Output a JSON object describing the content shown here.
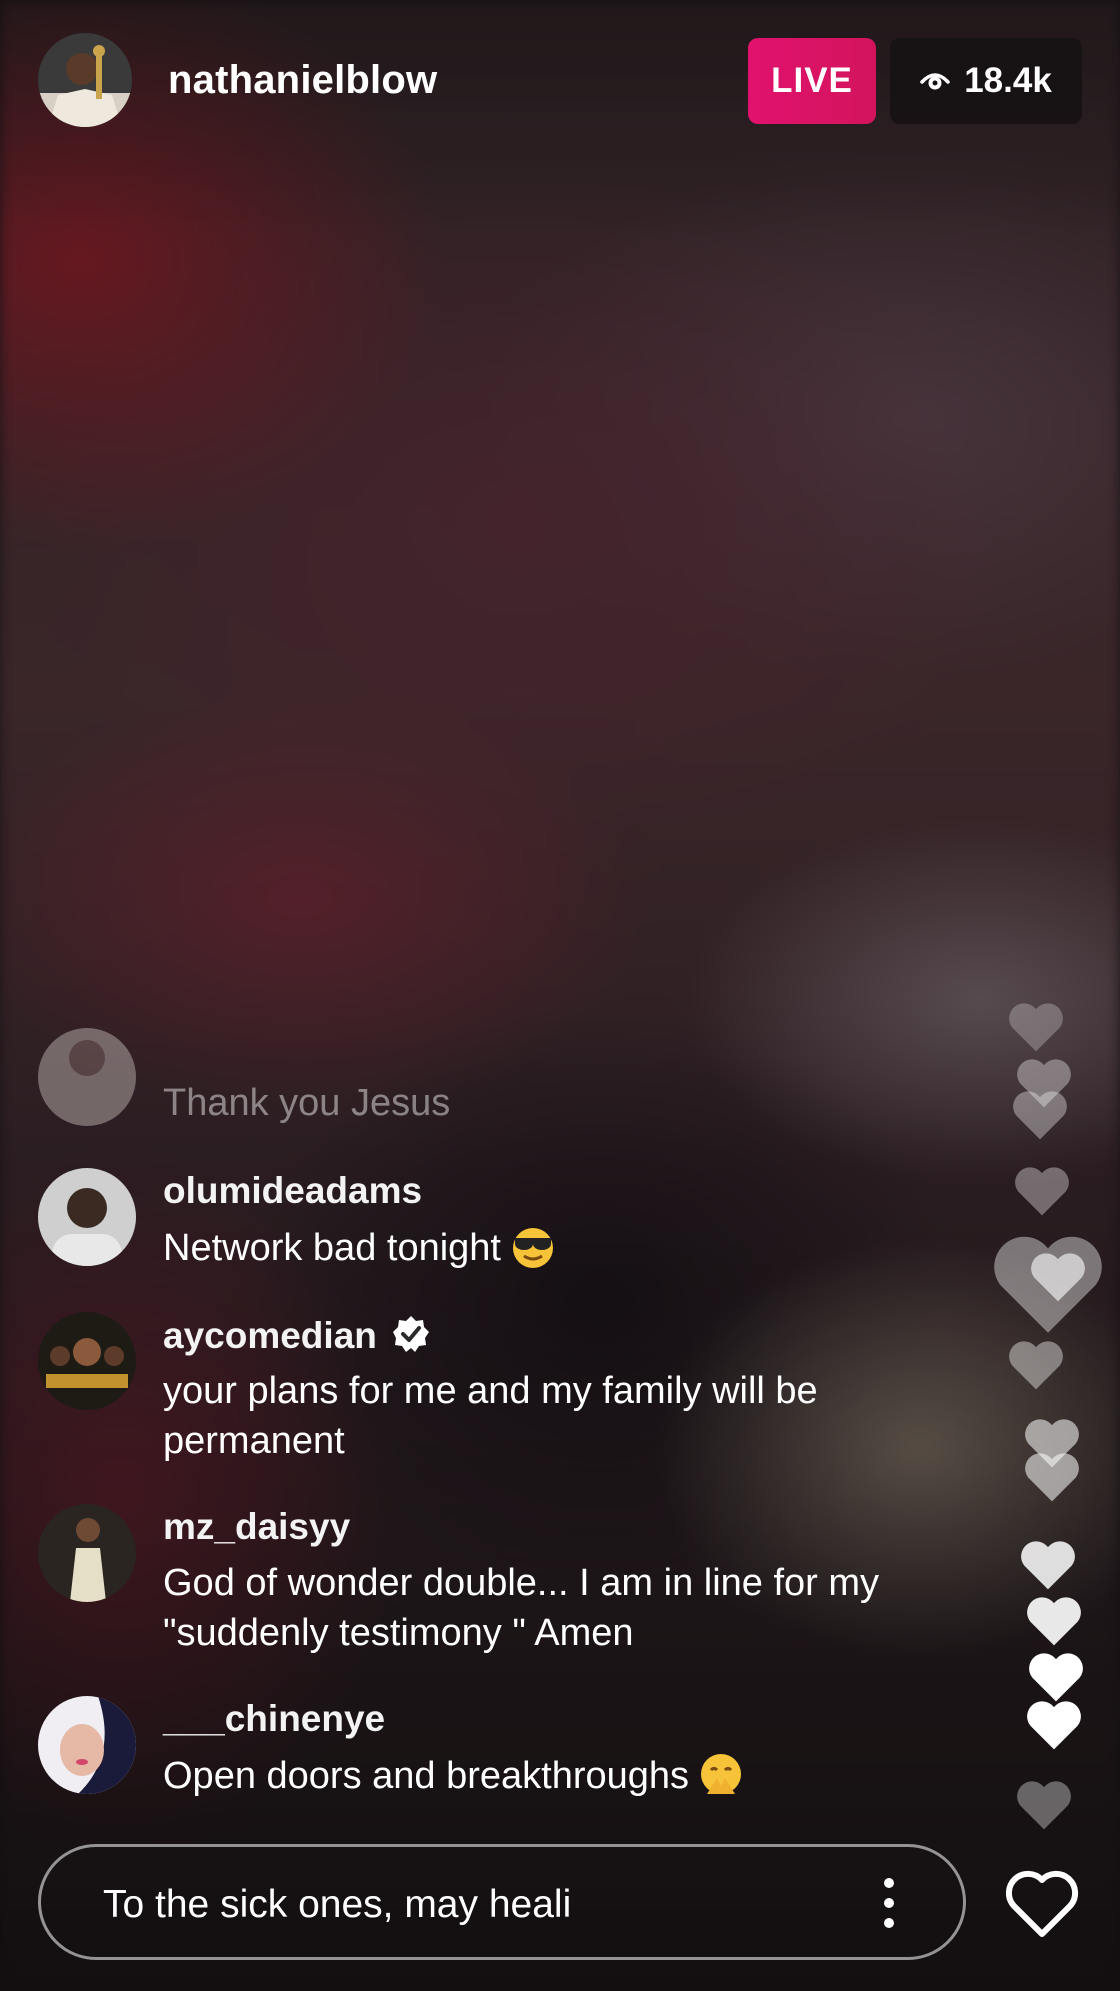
{
  "header": {
    "username": "nathanielblow",
    "live_label": "LIVE",
    "viewer_count": "18.4k",
    "viewer_icon": "eye-icon"
  },
  "comments": [
    {
      "user": "",
      "text": "Thank you Jesus",
      "faded": true
    },
    {
      "user": "olumideadams",
      "text": "Network bad tonight",
      "emoji": "sunglasses-face"
    },
    {
      "user": "aycomedian",
      "verified": true,
      "text": "your plans for me and my family  will be permanent"
    },
    {
      "user": "mz_daisyy",
      "text": "God of wonder double... I am in line for my \"suddenly testimony \" Amen"
    },
    {
      "user": "___chinenye",
      "text": "Open doors and breakthroughs",
      "emoji": "praying-face"
    }
  ],
  "composer": {
    "draft_text": "To the sick ones,  may heali",
    "options_icon": "more-vertical-icon",
    "like_icon": "heart-outline-icon"
  },
  "colors": {
    "live_badge": "#e0126e",
    "viewer_badge_bg": "#141012"
  }
}
